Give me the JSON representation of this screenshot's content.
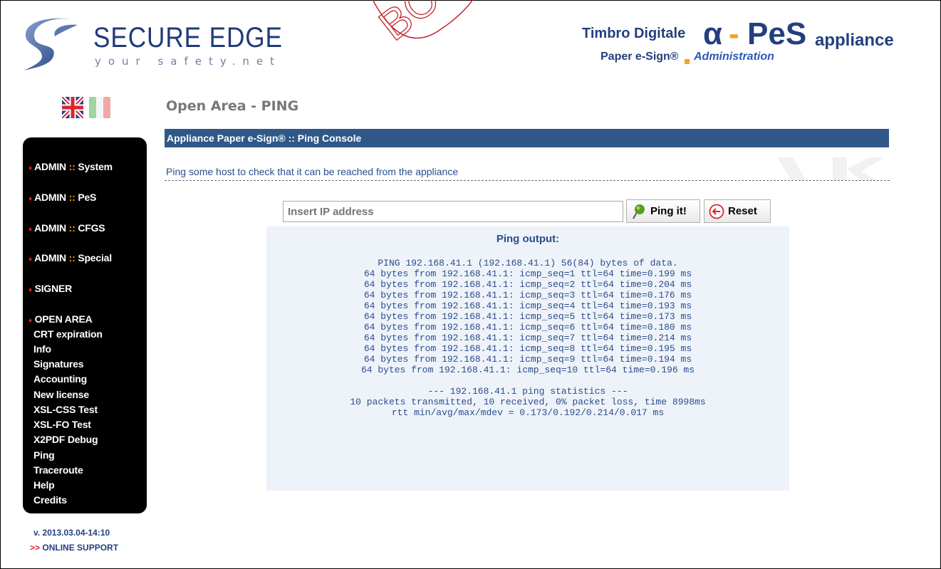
{
  "header": {
    "brand_name": "SECURE EDGE",
    "brand_tagline": "your safety.net",
    "product_prefix": "Timbro Digitale",
    "product_alpha": "α",
    "product_dash": "-",
    "product_pes": "PeS",
    "product_suffix": "appliance",
    "product_sub1": "Paper e-Sign®",
    "product_sub2": "Administration",
    "watermark_text": "BO"
  },
  "languages": [
    "en-flag",
    "it-flag"
  ],
  "sidebar": {
    "items": [
      {
        "prefix": "ADMIN",
        "sep": "::",
        "label": "System"
      },
      {
        "prefix": "ADMIN",
        "sep": "::",
        "label": "PeS"
      },
      {
        "prefix": "ADMIN",
        "sep": "::",
        "label": "CFGS"
      },
      {
        "prefix": "ADMIN",
        "sep": "::",
        "label": "Special"
      },
      {
        "prefix": "SIGNER",
        "sep": "",
        "label": ""
      },
      {
        "prefix": "OPEN AREA",
        "sep": "",
        "label": ""
      }
    ],
    "sub_items": [
      "CRT expiration",
      "Info",
      "Signatures",
      "Accounting",
      "New license",
      "XSL-CSS Test",
      "XSL-FO Test",
      "X2PDF Debug",
      "Ping",
      "Traceroute",
      "Help",
      "Credits"
    ]
  },
  "footer": {
    "version": "v. 2013.03.04-14:10",
    "support_arrows": ">>",
    "support_label": "ONLINE SUPPORT"
  },
  "main": {
    "page_title": "Open Area - PING",
    "console_title": "Appliance Paper e-Sign® :: Ping Console",
    "description": "Ping some host to check that it can be reached from the appliance",
    "input_placeholder": "Insert IP address",
    "ping_button": "Ping it!",
    "reset_button": "Reset",
    "output_title": "Ping output:",
    "output_lines": [
      "PING 192.168.41.1 (192.168.41.1) 56(84) bytes of data.",
      "64 bytes from 192.168.41.1: icmp_seq=1 ttl=64 time=0.199 ms",
      "64 bytes from 192.168.41.1: icmp_seq=2 ttl=64 time=0.204 ms",
      "64 bytes from 192.168.41.1: icmp_seq=3 ttl=64 time=0.176 ms",
      "64 bytes from 192.168.41.1: icmp_seq=4 ttl=64 time=0.193 ms",
      "64 bytes from 192.168.41.1: icmp_seq=5 ttl=64 time=0.173 ms",
      "64 bytes from 192.168.41.1: icmp_seq=6 ttl=64 time=0.180 ms",
      "64 bytes from 192.168.41.1: icmp_seq=7 ttl=64 time=0.214 ms",
      "64 bytes from 192.168.41.1: icmp_seq=8 ttl=64 time=0.195 ms",
      "64 bytes from 192.168.41.1: icmp_seq=9 ttl=64 time=0.194 ms",
      "64 bytes from 192.168.41.1: icmp_seq=10 ttl=64 time=0.196 ms",
      "",
      "--- 192.168.41.1 ping statistics ---",
      "10 packets transmitted, 10 received, 0% packet loss, time 8998ms",
      "rtt min/avg/max/mdev = 0.173/0.192/0.214/0.017 ms"
    ]
  },
  "colors": {
    "accent_blue": "#2f5888",
    "brand_navy": "#243f7f",
    "highlight_orange": "#f4a11a",
    "marker_red": "#e0231f",
    "output_bg": "#eef3f9"
  }
}
